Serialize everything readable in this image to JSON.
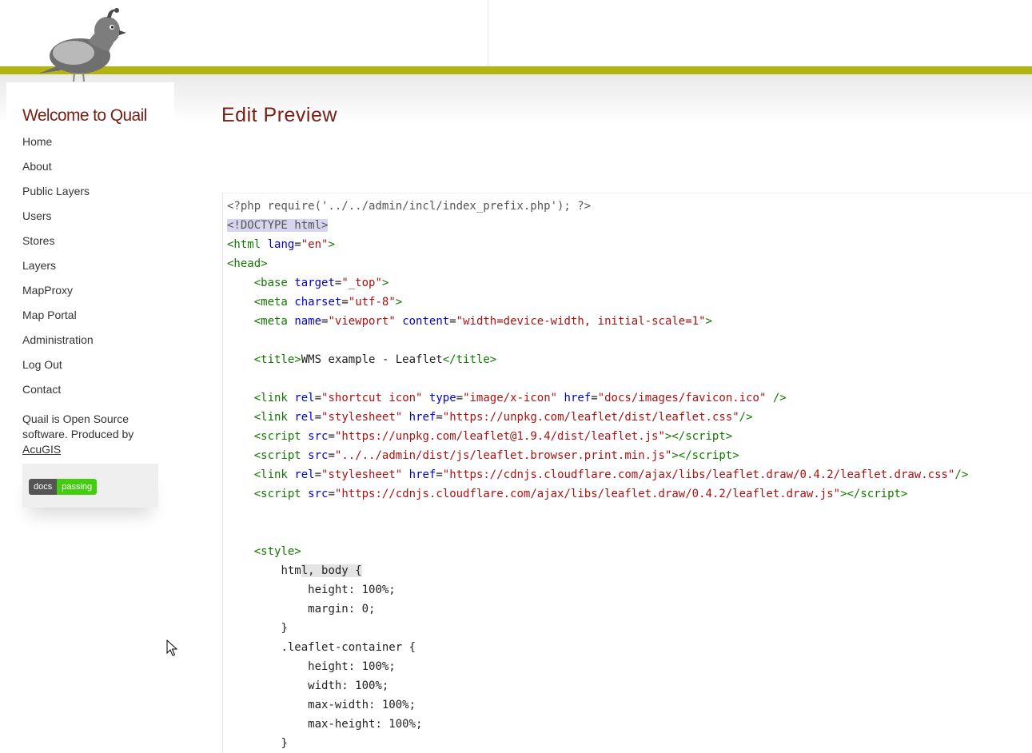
{
  "sidebar": {
    "title": "Welcome to Quail",
    "items": [
      {
        "label": "Home"
      },
      {
        "label": "About"
      },
      {
        "label": "Public Layers"
      },
      {
        "label": "Users"
      },
      {
        "label": "Stores"
      },
      {
        "label": "Layers"
      },
      {
        "label": "MapProxy"
      },
      {
        "label": "Map Portal"
      },
      {
        "label": "Administration"
      },
      {
        "label": "Log Out"
      },
      {
        "label": "Contact"
      }
    ],
    "oss_text": "Quail is Open Source software. Produced by",
    "oss_link": "AcuGIS",
    "badge": {
      "left": "docs",
      "right": "passing"
    }
  },
  "main": {
    "title": "Edit Preview",
    "code": {
      "l1": "<?php require('../../admin/incl/index_prefix.php'); ?>",
      "doctype": "<!DOCTYPE html>",
      "base_target": "\"_top\"",
      "meta_charset": "\"utf-8\"",
      "meta_name": "\"viewport\"",
      "meta_content": "\"width=device-width, initial-scale=1\"",
      "title_text": "WMS example - Leaflet",
      "link1_rel": "\"shortcut icon\"",
      "link1_type": "\"image/x-icon\"",
      "link1_href": "\"docs/images/favicon.ico\"",
      "link2_rel": "\"stylesheet\"",
      "link2_href": "\"https://unpkg.com/leaflet/dist/leaflet.css\"",
      "script1_src": "\"https://unpkg.com/leaflet@1.9.4/dist/leaflet.js\"",
      "script2_src": "\"../../admin/dist/js/leaflet.browser.print.min.js\"",
      "link3_rel": "\"stylesheet\"",
      "link3_href": "\"https://cdnjs.cloudflare.com/ajax/libs/leaflet.draw/0.4.2/leaflet.draw.css\"",
      "script3_src": "\"https://cdnjs.cloudflare.com/ajax/libs/leaflet.draw/0.4.2/leaflet.draw.js\"",
      "css_sel1_a": "htm",
      "css_sel1_b": "l, body {",
      "css_height": "height: 100%;",
      "css_margin": "margin: 0;",
      "css_close": "}",
      "css_sel2": ".leaflet-container {",
      "css_width": "width: 100%;",
      "css_maxwidth": "max-width: 100%;",
      "css_maxheight": "max-height: 100%;"
    }
  },
  "icons": {
    "logo": "quail-bird-logo",
    "cursor": "mouse-pointer-icon"
  },
  "colors": {
    "accent_bar": "#b5b30e",
    "title": "#7a1d12",
    "code_tag": "#117700",
    "code_attr": "#0000cc",
    "code_string": "#aa1111"
  }
}
